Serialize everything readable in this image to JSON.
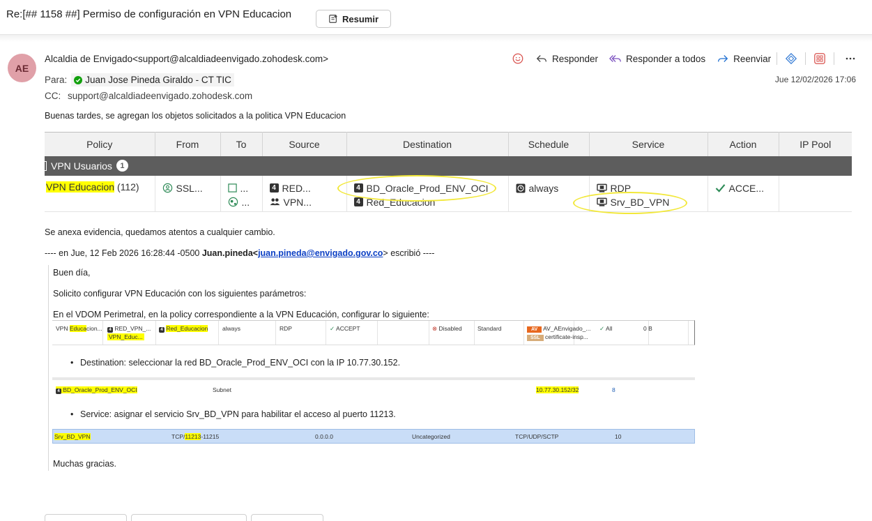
{
  "header": {
    "subject": "Re:[## 1158 ##] Permiso de configuración en VPN Educacion",
    "summarize_label": "Resumir"
  },
  "sender": {
    "initials": "AE",
    "from": "Alcaldia de Envigado<support@alcaldiadeenvigado.zohodesk.com>",
    "to_label": "Para:",
    "to_name": "Juan Jose Pineda Giraldo - CT TIC",
    "cc_label": "CC:",
    "cc_value": "support@alcaldiadeenvigado.zohodesk.com",
    "date": "Jue 12/02/2026 17:06"
  },
  "actions": {
    "reply": "Responder",
    "reply_all": "Responder a todos",
    "forward": "Reenviar"
  },
  "body": {
    "greeting": "Buenas tardes, se agregan los objetos solicitados a la politica VPN Educacion",
    "table": {
      "headers": [
        "Policy",
        "From",
        "To",
        "Source",
        "Destination",
        "Schedule",
        "Service",
        "Action",
        "IP Pool"
      ],
      "group_name": "VPN Usuarios",
      "group_count": "1",
      "policy_name": "VPN Educacion",
      "policy_id": "(112)",
      "from": "SSL...",
      "to": [
        "",
        ""
      ],
      "to_line1": "...",
      "to_line2": "...",
      "source": [
        "RED...",
        "VPN..."
      ],
      "destination": [
        "BD_Oracle_Prod_ENV_OCI",
        "Red_Educacion"
      ],
      "schedule": "always",
      "service": [
        "RDP",
        "Srv_BD_VPN"
      ],
      "action": "ACCE..."
    },
    "annex": "Se anexa evidencia, quedamos atentos a cualquier cambio.",
    "quote_header_prefix": "---- en Jue, 12 Feb 2026 16:28:44 -0500 ",
    "quote_sender": "Juan.pineda<",
    "quote_email": "juan.pineda@envigado.gov.co",
    "quote_header_suffix": "> escribió ----",
    "quote": {
      "line1": "Buen día,",
      "line2": "Solicito configurar VPN Educación con los siguientes parámetros:",
      "line3": "En el VDOM Perimetral, en la policy correspondiente a la VPN Educación, configurar lo siguiente:",
      "bullet1": "Destination: seleccionar la red BD_Oracle_Prod_ENV_OCI con la IP 10.77.30.152.",
      "bullet2": "Service: asignar el servicio Srv_BD_VPN para habilitar el acceso al puerto 11213.",
      "closing": "Muchas gracias."
    },
    "snip1": {
      "policy_pre": "VPN ",
      "policy_hl": "Educa",
      "policy_post": "cion...",
      "src1": "RED_VPN_...",
      "src2": "VPN_Educ...",
      "dst": "Red_Educacion",
      "sched": "always",
      "svc": "RDP",
      "act": "ACCEPT",
      "disabled": "Disabled",
      "standard": "Standard",
      "av": "AV",
      "av_name": "AV_AEnvigado_...",
      "ssl": "SSL",
      "ssl_name": "certificate-insp...",
      "all": "All",
      "bytes": "0 B"
    },
    "snip2": {
      "name": "BD_Oracle_Prod_ENV_OCI",
      "type": "Subnet",
      "ip": "10.77.30.152/32",
      "ref": "8"
    },
    "snip3": {
      "name": "Srv_BD_VPN",
      "proto_pre": "TCP/",
      "proto_hl": "11213",
      "proto_post": "-11215",
      "addr": "0.0.0.0",
      "cat": "Uncategorized",
      "proto2": "TCP/UDP/SCTP",
      "ref": "10"
    }
  },
  "colors": {
    "highlight": "#ffff00",
    "group_bar": "#5d5d5d",
    "avatar_bg": "#e0a0a8",
    "link": "#0b3fc4",
    "accept_green": "#2e8b57"
  }
}
